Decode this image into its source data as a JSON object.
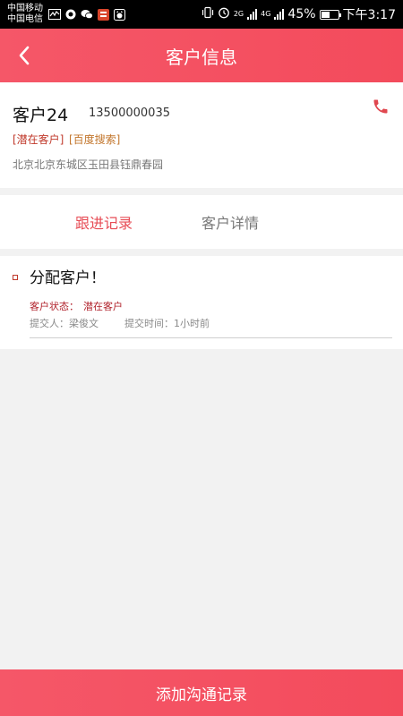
{
  "statusbar": {
    "carrier1": "中国移动",
    "carrier2": "中国电信",
    "net1": "2G",
    "net2": "4G",
    "battery": "45%",
    "time": "下午3:17"
  },
  "header": {
    "title": "客户信息",
    "back_icon": "chevron-left-icon"
  },
  "customer": {
    "name": "客户24",
    "phone": "13500000035",
    "tag_status": "[潜在客户]",
    "tag_source": "[百度搜索]",
    "address": "北京北京东城区玉田县钰鼎春园",
    "call_icon": "phone-icon"
  },
  "tabs": [
    {
      "label": "跟进记录",
      "active": true
    },
    {
      "label": "客户详情",
      "active": false
    }
  ],
  "records": [
    {
      "title": "分配客户！",
      "status_label": "客户状态：",
      "status_value": "潜在客户",
      "submitter": "提交人：梁俊文",
      "time": "提交时间：1小时前"
    }
  ],
  "bottom_button": {
    "label": "添加沟通记录"
  },
  "colors": {
    "accent": "#f34b5c",
    "tag_red": "#c0392b",
    "tag_orange": "#c2752b"
  }
}
